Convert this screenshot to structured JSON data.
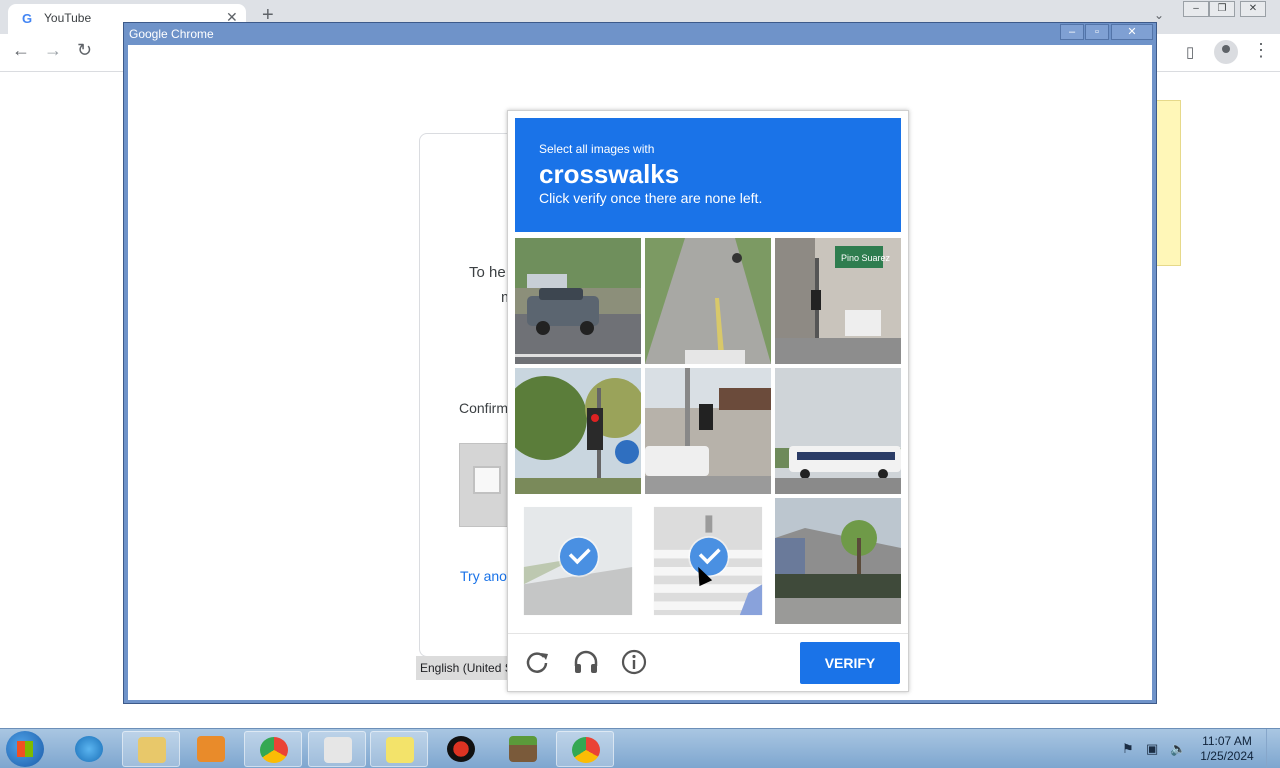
{
  "browser": {
    "tab_title": "YouTube",
    "favicon": "G",
    "new_tab": "+",
    "tab_close": "✕"
  },
  "popup": {
    "title": "Google Chrome",
    "min": "–",
    "max": "▫",
    "close": "✕"
  },
  "card": {
    "line1": "To he",
    "line2": "m",
    "confirm": "Confirm",
    "try_another": "Try anot",
    "language": "English (United S"
  },
  "recaptcha": {
    "instruction_small": "Select all images with",
    "target": "crosswalks",
    "instruction_sub": "Click verify once there are none left.",
    "tiles": [
      {
        "label": "car on road",
        "selected": false
      },
      {
        "label": "road with motorcycle",
        "selected": false
      },
      {
        "label": "street sign Pino Suarez",
        "selected": false
      },
      {
        "label": "traffic light and trees",
        "selected": false
      },
      {
        "label": "street intersection",
        "selected": false
      },
      {
        "label": "bus on road",
        "selected": false
      },
      {
        "label": "road",
        "selected": true
      },
      {
        "label": "crosswalk",
        "selected": true
      },
      {
        "label": "building and tree",
        "selected": false
      }
    ],
    "reload_icon": "reload-icon",
    "audio_icon": "headphones-icon",
    "info_icon": "info-icon",
    "verify_label": "VERIFY",
    "accent": "#1a73e8"
  },
  "taskbar": {
    "time": "11:07 AM",
    "date": "1/25/2024"
  }
}
